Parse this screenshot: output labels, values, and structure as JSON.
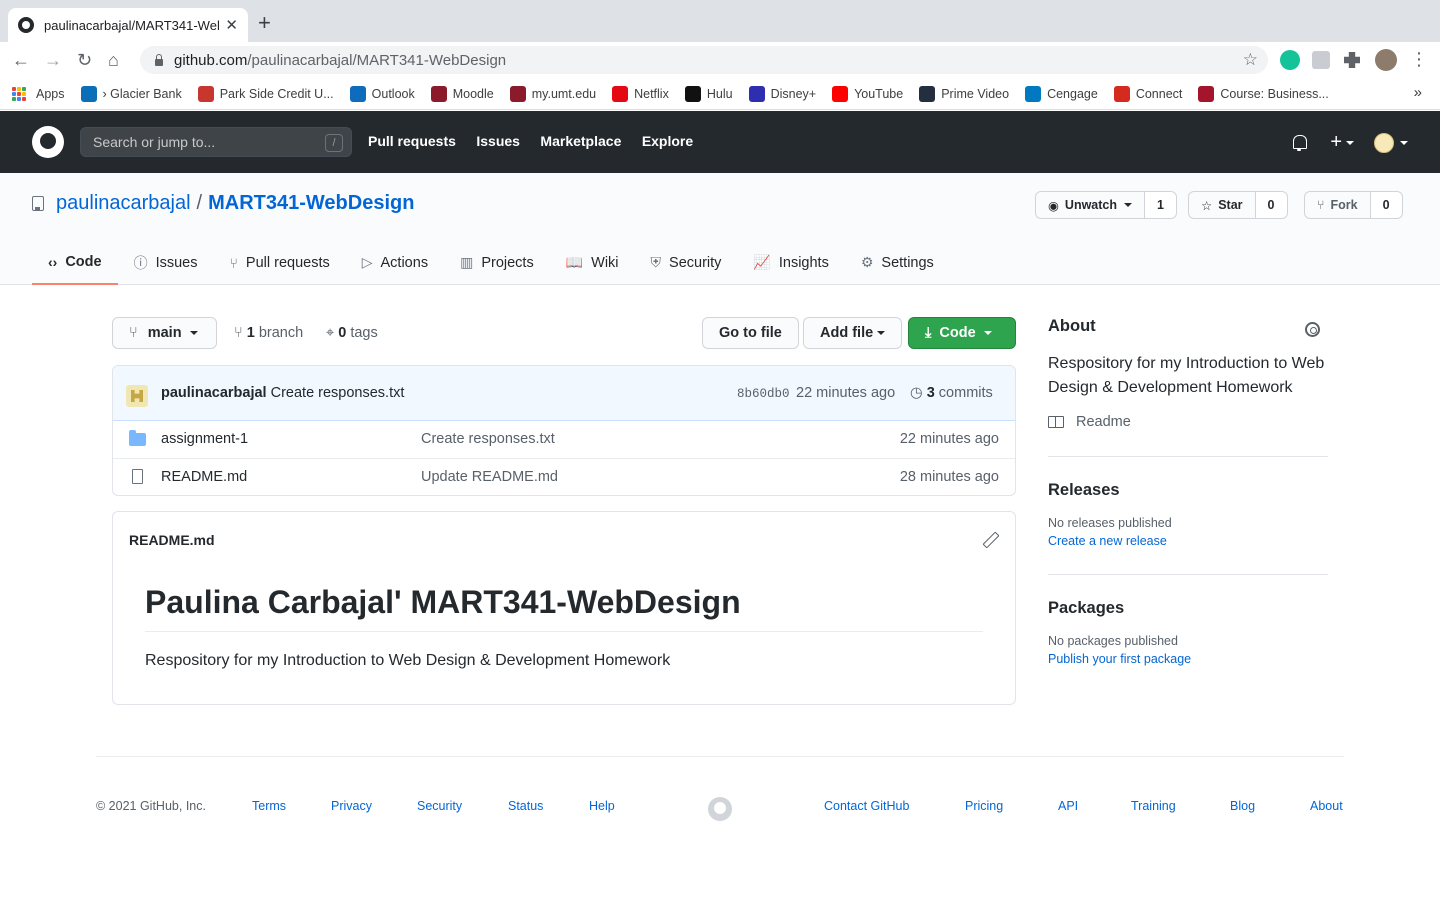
{
  "browser": {
    "tab_title": "paulinacarbajal/MART341-Web",
    "new_tab": "+",
    "url_host": "github.com",
    "url_path": "/paulinacarbajal/MART341-WebDesign",
    "bookmarks": [
      {
        "label": "Apps",
        "icon": "apps-grid-icon"
      },
      {
        "label": "› Glacier Bank",
        "icon": "glacier-bank-icon",
        "color": "#0b6fb8"
      },
      {
        "label": "Park Side Credit U...",
        "icon": "park-side-icon",
        "color": "#c7372f"
      },
      {
        "label": "Outlook",
        "icon": "outlook-icon",
        "color": "#0f6cbd"
      },
      {
        "label": "Moodle",
        "icon": "moodle-icon",
        "color": "#8b1a2b"
      },
      {
        "label": "my.umt.edu",
        "icon": "umt-icon",
        "color": "#8b1a2b"
      },
      {
        "label": "Netflix",
        "icon": "netflix-icon",
        "color": "#e50914"
      },
      {
        "label": "Hulu",
        "icon": "hulu-icon",
        "color": "#111111"
      },
      {
        "label": "Disney+",
        "icon": "disney-icon",
        "color": "#2e2fb0"
      },
      {
        "label": "YouTube",
        "icon": "youtube-icon",
        "color": "#ff0000"
      },
      {
        "label": "Prime Video",
        "icon": "amazon-icon",
        "color": "#232f3e"
      },
      {
        "label": "Cengage",
        "icon": "cengage-icon",
        "color": "#0079c1"
      },
      {
        "label": "Connect",
        "icon": "connect-icon",
        "color": "#d52b1e"
      },
      {
        "label": "Course: Business...",
        "icon": "power-icon",
        "color": "#a4152c"
      }
    ],
    "more": "»"
  },
  "github": {
    "search_placeholder": "Search or jump to...",
    "search_shortcut": "/",
    "nav": [
      "Pull requests",
      "Issues",
      "Marketplace",
      "Explore"
    ]
  },
  "repo": {
    "owner": "paulinacarbajal",
    "separator": "/",
    "name": "MART341-WebDesign",
    "watch_label": "Unwatch",
    "watch_count": "1",
    "star_label": "Star",
    "star_count": "0",
    "fork_label": "Fork",
    "fork_count": "0",
    "tabs": [
      {
        "label": "Code",
        "icon": "‹›"
      },
      {
        "label": "Issues",
        "icon": "ⓘ"
      },
      {
        "label": "Pull requests",
        "icon": "⑂"
      },
      {
        "label": "Actions",
        "icon": "▷"
      },
      {
        "label": "Projects",
        "icon": "▥"
      },
      {
        "label": "Wiki",
        "icon": "📖"
      },
      {
        "label": "Security",
        "icon": "⛨"
      },
      {
        "label": "Insights",
        "icon": "📈"
      },
      {
        "label": "Settings",
        "icon": "⚙"
      }
    ],
    "active_tab": "Code"
  },
  "filebar": {
    "branch": "main",
    "branch_count": "1",
    "branch_word": "branch",
    "tag_count": "0",
    "tag_word": "tags",
    "go_to_file": "Go to file",
    "add_file": "Add file",
    "code": "Code"
  },
  "commit": {
    "author": "paulinacarbajal",
    "message": "Create responses.txt",
    "sha": "8b60db0",
    "ago": "22 minutes ago",
    "commit_count": "3",
    "commit_word": "commits"
  },
  "files": [
    {
      "type": "folder",
      "name": "assignment-1",
      "message": "Create responses.txt",
      "age": "22 minutes ago"
    },
    {
      "type": "file",
      "name": "README.md",
      "message": "Update README.md",
      "age": "28 minutes ago"
    }
  ],
  "readme": {
    "filename": "README.md",
    "heading": "Paulina Carbajal' MART341-WebDesign",
    "body": "Respository for my Introduction to Web Design & Development Homework"
  },
  "sidebar": {
    "about_title": "About",
    "about_desc": "Respository for my Introduction to Web Design & Development Homework",
    "readme_label": "Readme",
    "releases_title": "Releases",
    "releases_none": "No releases published",
    "releases_link": "Create a new release",
    "packages_title": "Packages",
    "packages_none": "No packages published",
    "packages_link": "Publish your first package"
  },
  "footer": {
    "copyright": "© 2021 GitHub, Inc.",
    "left_links": [
      "Terms",
      "Privacy",
      "Security",
      "Status",
      "Help"
    ],
    "right_links": [
      "Contact GitHub",
      "Pricing",
      "API",
      "Training",
      "Blog",
      "About"
    ]
  }
}
